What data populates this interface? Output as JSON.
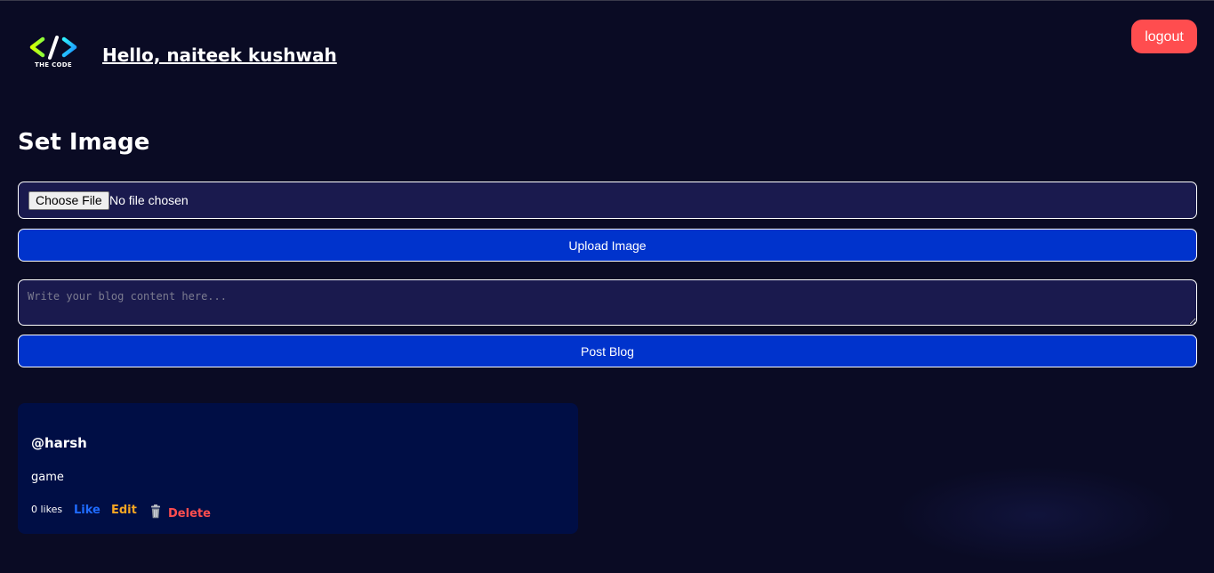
{
  "header": {
    "logo_text": "THE CODE",
    "greeting": "Hello, naiteek kushwah",
    "logout_label": "logout"
  },
  "upload": {
    "title": "Set Image",
    "choose_file_label": "Choose File",
    "file_status": "No file chosen",
    "upload_button_label": "Upload Image"
  },
  "composer": {
    "placeholder": "Write your blog content here...",
    "post_button_label": "Post Blog"
  },
  "posts": [
    {
      "author": "@harsh",
      "content": "game",
      "likes": "0 likes",
      "like_label": "Like",
      "edit_label": "Edit",
      "delete_label": "Delete",
      "delete_icon": "trash-icon"
    }
  ],
  "colors": {
    "background": "#0a0b24",
    "input_background": "#1a1a4e",
    "primary_button": "#0033cc",
    "logout_button": "#ff4d4f",
    "card_background": "#000e45",
    "like": "#1f6bff",
    "edit": "#f5a623",
    "delete": "#ff4d4f"
  }
}
